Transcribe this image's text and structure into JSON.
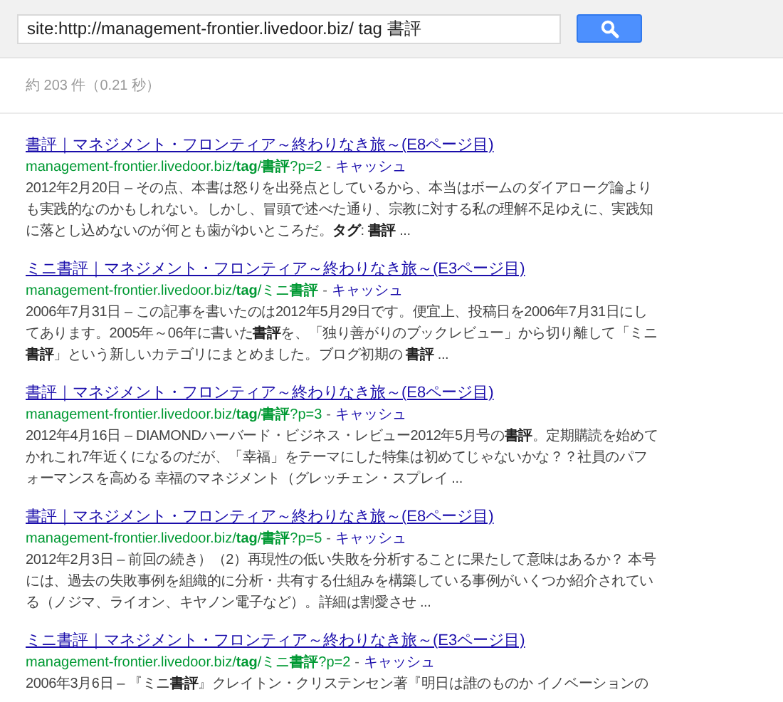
{
  "search": {
    "query": "site:http://management-frontier.livedoor.biz/ tag 書評"
  },
  "stats": "約 203 件（0.21 秒）",
  "results": [
    {
      "title": "書評｜マネジメント・フロンティア～終わりなき旅～(E8ページ目)",
      "url": "management-frontier.livedoor.biz/**tag**/**書評**?p=2",
      "separator": "-",
      "cache": "キャッシュ",
      "snippet": "2012年2月20日 – その点、本書は怒りを出発点としているから、本当はボームのダイアローグ論よりも実践的なのかもしれない。しかし、冒頭で述べた通り、宗教に対する私の理解不足ゆえに、実践知に落とし込めないのが何とも歯がゆいところだ。**タグ**: **書評** ..."
    },
    {
      "title": "ミニ書評｜マネジメント・フロンティア～終わりなき旅～(E3ページ目)",
      "url": "management-frontier.livedoor.biz/**tag**/ミニ**書評**",
      "separator": "-",
      "cache": "キャッシュ",
      "snippet": "2006年7月31日 – この記事を書いたのは2012年5月29日です。便宜上、投稿日を2006年7月31日にしてあります。2005年～06年に書いた**書評**を、「独り善がりのブックレビュー」から切り離して「ミニ**書評**」という新しいカテゴリにまとめました。ブログ初期の **書評** ..."
    },
    {
      "title": "書評｜マネジメント・フロンティア～終わりなき旅～(E8ページ目)",
      "url": "management-frontier.livedoor.biz/**tag**/**書評**?p=3",
      "separator": "-",
      "cache": "キャッシュ",
      "snippet": "2012年4月16日 – DIAMONDハーバード・ビジネス・レビュー2012年5月号の**書評**。定期購読を始めてかれこれ7年近くになるのだが、「幸福」をテーマにした特集は初めてじゃないかな？？社員のパフォーマンスを高める 幸福のマネジメント（グレッチェン・スプレイ ..."
    },
    {
      "title": "書評｜マネジメント・フロンティア～終わりなき旅～(E8ページ目)",
      "url": "management-frontier.livedoor.biz/**tag**/**書評**?p=5",
      "separator": "-",
      "cache": "キャッシュ",
      "snippet": "2012年2月3日 – 前回の続き）（2）再現性の低い失敗を分析することに果たして意味はあるか？ 本号には、過去の失敗事例を組織的に分析・共有する仕組みを構築している事例がいくつか紹介されている（ノジマ、ライオン、キヤノン電子など）。詳細は割愛させ ..."
    },
    {
      "title": "ミニ書評｜マネジメント・フロンティア～終わりなき旅～(E3ページ目)",
      "url": "management-frontier.livedoor.biz/**tag**/ミニ**書評**?p=2",
      "separator": "-",
      "cache": "キャッシュ",
      "snippet": "2006年3月6日 – 『ミニ**書評**』クレイトン・クリステンセン著『明日は誰のものか イノベーションの"
    }
  ]
}
